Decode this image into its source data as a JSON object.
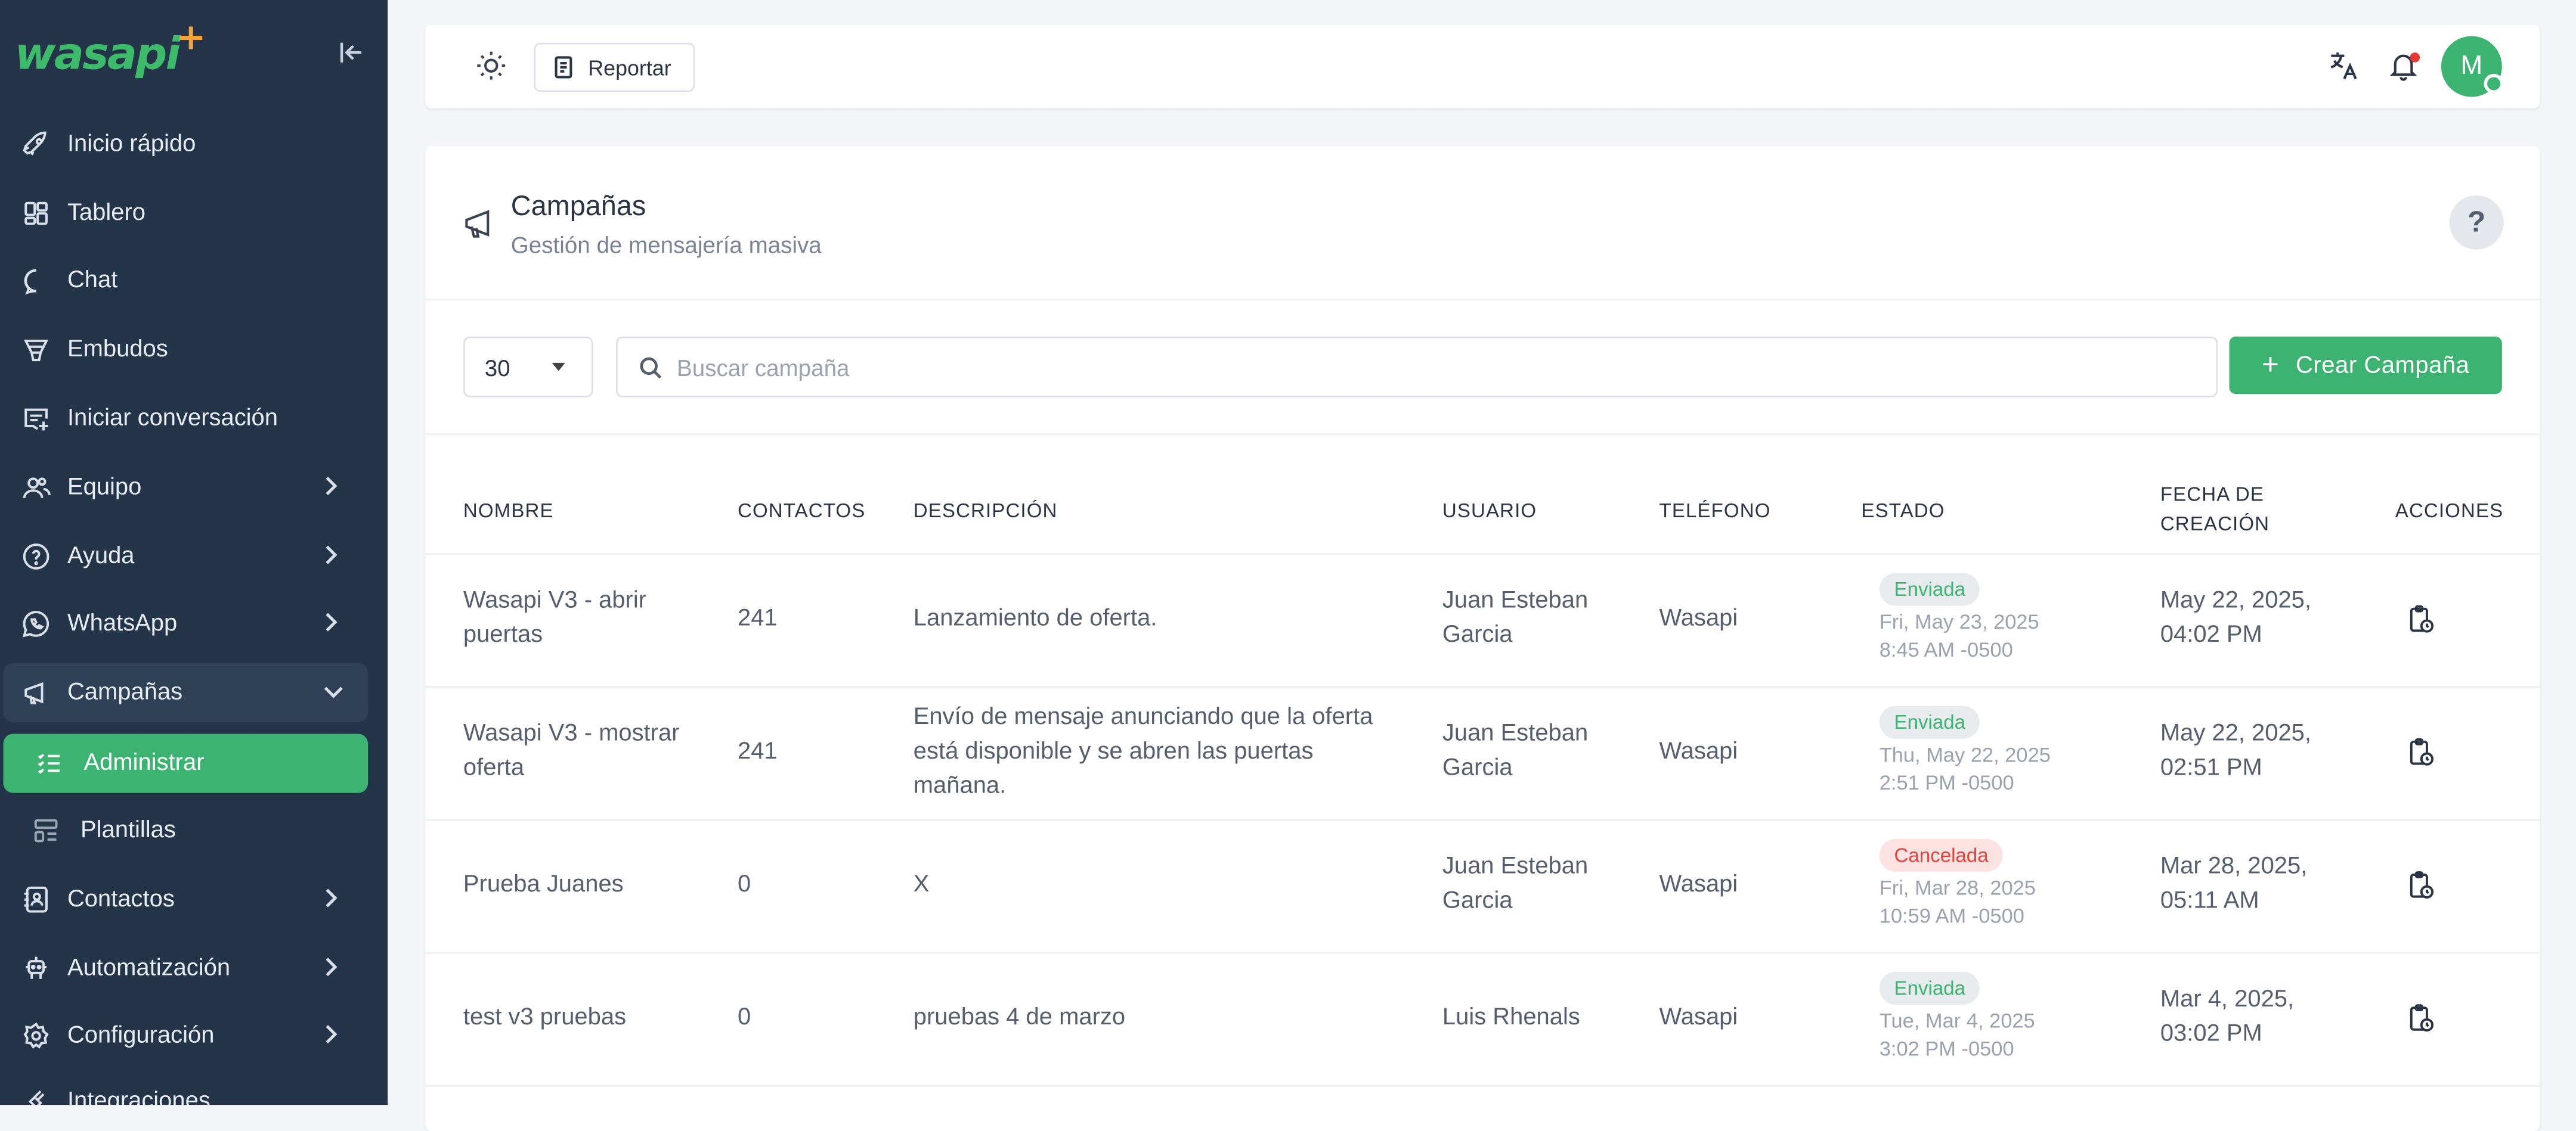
{
  "app": {
    "logo_text": "wasapi",
    "logo_plus": "+"
  },
  "colors": {
    "brand_green": "#3cb371",
    "sidebar_bg": "#243449",
    "accent_orange": "#f2a23a",
    "canceled_red": "#e0443c"
  },
  "sidebar": {
    "items": [
      {
        "label": "Inicio rápido",
        "icon": "rocket-icon"
      },
      {
        "label": "Tablero",
        "icon": "dashboard-icon"
      },
      {
        "label": "Chat",
        "icon": "chat-bubble-icon"
      },
      {
        "label": "Embudos",
        "icon": "funnel-icon"
      },
      {
        "label": "Iniciar conversación",
        "icon": "new-message-icon"
      },
      {
        "label": "Equipo",
        "icon": "team-icon"
      },
      {
        "label": "Ayuda",
        "icon": "help-circle-icon"
      },
      {
        "label": "WhatsApp",
        "icon": "whatsapp-icon"
      },
      {
        "label": "Campañas",
        "icon": "megaphone-icon"
      },
      {
        "label": "Administrar",
        "icon": "list-check-icon"
      },
      {
        "label": "Plantillas",
        "icon": "template-icon"
      },
      {
        "label": "Contactos",
        "icon": "contacts-icon"
      },
      {
        "label": "Automatización",
        "icon": "robot-icon"
      },
      {
        "label": "Configuración",
        "icon": "gear-icon"
      },
      {
        "label": "Integraciones",
        "icon": "plug-icon"
      }
    ]
  },
  "topbar": {
    "report_label": "Reportar",
    "avatar_initial": "M"
  },
  "page": {
    "title": "Campañas",
    "subtitle": "Gestión de mensajería masiva",
    "help_symbol": "?"
  },
  "toolbar": {
    "page_size": "30",
    "search_placeholder": "Buscar campaña",
    "create_label": "Crear Campaña",
    "create_plus": "+"
  },
  "table": {
    "headers": [
      "NOMBRE",
      "CONTACTOS",
      "DESCRIPCIÓN",
      "USUARIO",
      "TELÉFONO",
      "ESTADO",
      "FECHA DE CREACIÓN",
      "ACCIONES"
    ],
    "rows": [
      {
        "name": "Wasapi V3 - abrir puertas",
        "contacts": "241",
        "description": "Lanzamiento de oferta.",
        "user": "Juan Esteban Garcia",
        "phone": "Wasapi",
        "status": "Enviada",
        "status_date": "Fri, May 23, 2025",
        "status_time": "8:45 AM -0500",
        "created": "May 22, 2025, 04:02 PM"
      },
      {
        "name": "Wasapi V3 - mostrar oferta",
        "contacts": "241",
        "description": "Envío de mensaje anunciando que la oferta está disponible y se abren las puertas mañana.",
        "user": "Juan Esteban Garcia",
        "phone": "Wasapi",
        "status": "Enviada",
        "status_date": "Thu, May 22, 2025",
        "status_time": "2:51 PM -0500",
        "created": "May 22, 2025, 02:51 PM"
      },
      {
        "name": "Prueba Juanes",
        "contacts": "0",
        "description": "X",
        "user": "Juan Esteban Garcia",
        "phone": "Wasapi",
        "status": "Cancelada",
        "status_date": "Fri, Mar 28, 2025",
        "status_time": "10:59 AM -0500",
        "created": "Mar 28, 2025, 05:11 AM"
      },
      {
        "name": "test v3 pruebas",
        "contacts": "0",
        "description": "pruebas 4 de marzo",
        "user": "Luis Rhenals",
        "phone": "Wasapi",
        "status": "Enviada",
        "status_date": "Tue, Mar 4, 2025",
        "status_time": "3:02 PM -0500",
        "created": "Mar 4, 2025, 03:02 PM"
      }
    ]
  }
}
